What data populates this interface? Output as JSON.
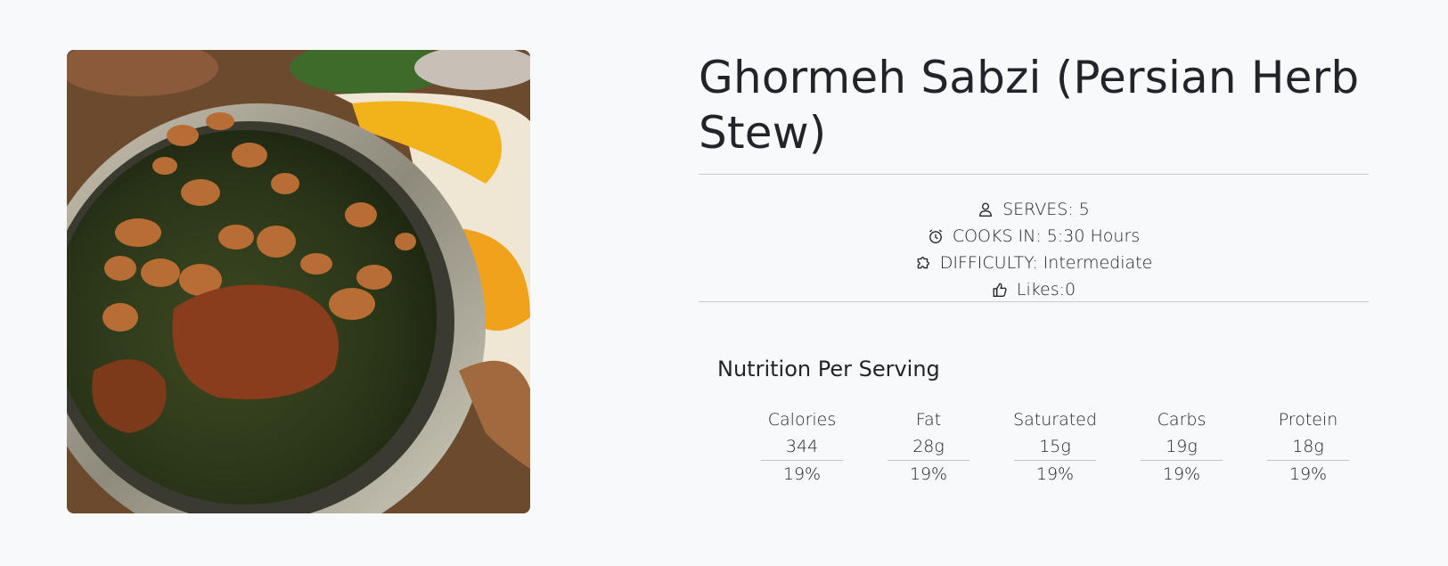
{
  "recipe": {
    "title": "Ghormeh Sabzi (Persian Herb Stew)",
    "image_alt": "Ghormeh Sabzi dish served with saffron rice"
  },
  "meta": {
    "serves": {
      "icon": "person-icon",
      "text": "SERVES: 5"
    },
    "cook_time": {
      "icon": "alarm-clock-icon",
      "text": "COOKS IN: 5:30 Hours"
    },
    "difficulty": {
      "icon": "puzzle-icon",
      "text": "DIFFICULTY: Intermediate"
    },
    "likes": {
      "icon": "thumbs-up-icon",
      "text": "Likes:0"
    }
  },
  "nutrition": {
    "title": "Nutrition Per Serving",
    "items": [
      {
        "label": "Calories",
        "value": "344",
        "percent": "19%"
      },
      {
        "label": "Fat",
        "value": "28g",
        "percent": "19%"
      },
      {
        "label": "Saturated",
        "value": "15g",
        "percent": "19%"
      },
      {
        "label": "Carbs",
        "value": "19g",
        "percent": "19%"
      },
      {
        "label": "Protein",
        "value": "18g",
        "percent": "19%"
      }
    ]
  }
}
